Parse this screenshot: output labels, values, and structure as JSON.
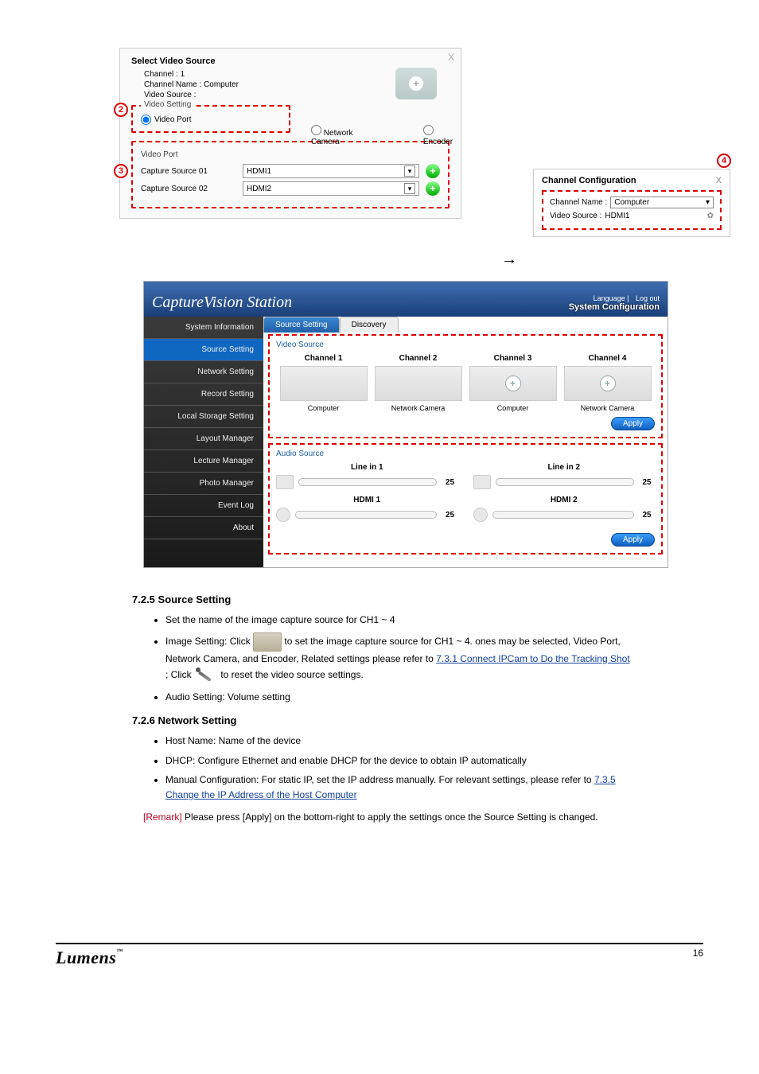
{
  "dialog": {
    "title": "Select Video Source",
    "channel_lbl": "Channel : 1",
    "channel_name_lbl": "Channel Name :  Computer",
    "video_source_lbl": "Video Source :",
    "video_setting_legend": "Video Setting",
    "radios": {
      "port": "Video Port",
      "cam": "Network Camera",
      "enc": "Encoder"
    },
    "video_port_title": "Video Port",
    "cap1_lbl": "Capture Source 01",
    "cap1_val": "HDMI1",
    "cap2_lbl": "Capture Source 02",
    "cap2_val": "HDMI2"
  },
  "cc": {
    "title": "Channel Configuration",
    "name_lbl": "Channel Name  :",
    "name_val": "Computer",
    "src_lbl": "Video Source   :",
    "src_val": "HDMI1"
  },
  "markers": {
    "m2": "2",
    "m3": "3",
    "m4": "4"
  },
  "cvs": {
    "title": "CaptureVision Station",
    "lang": "Language",
    "logout": "Log out",
    "syscfg": "System Configuration",
    "nav": {
      "sysinfo": "System Information",
      "source": "Source Setting",
      "network": "Network Setting",
      "record": "Record Setting",
      "storage": "Local Storage Setting",
      "layout": "Layout Manager",
      "lecture": "Lecture Manager",
      "photo": "Photo Manager",
      "event": "Event Log",
      "about": "About"
    },
    "tabs": {
      "source": "Source Setting",
      "discovery": "Discovery"
    },
    "video_src_title": "Video Source",
    "channels": {
      "c1": {
        "hd": "Channel 1",
        "cap": "Computer"
      },
      "c2": {
        "hd": "Channel 2",
        "cap": "Network Camera"
      },
      "c3": {
        "hd": "Channel 3",
        "cap": "Computer"
      },
      "c4": {
        "hd": "Channel 4",
        "cap": "Network Camera"
      }
    },
    "apply": "Apply",
    "audio_src_title": "Audio Source",
    "audio": {
      "l1": {
        "tt": "Line in 1",
        "val": "25"
      },
      "l2": {
        "tt": "Line in 2",
        "val": "25"
      },
      "h1": {
        "tt": "HDMI 1",
        "val": "25"
      },
      "h2": {
        "tt": "HDMI 2",
        "val": "25"
      }
    }
  },
  "sec": {
    "h725": "7.2.5 Source Setting",
    "b1": "Set the name of the image capture source for CH1 ~ 4",
    "b2a": "Image Setting: Click ",
    "b2b": " to set the image capture source for CH1 ~ 4. ",
    "b2c": "ones may be selected, Video Port, Network Camera, and Encoder, Related settings please refer to ",
    "b2link": "7.3.1 Connect IPCam to Do the Tracking Shot",
    "b2d": "; Click ",
    "b2e": " to reset the video source settings.",
    "b3": "Audio Setting: Volume setting",
    "h726": "7.2.6 Network Setting",
    "c1": "Host Name: Name of the device",
    "c2": "DHCP: Configure Ethernet and enable DHCP for the device to obtain IP automatically",
    "c3a": "Manual Configuration: For static IP, set the IP address manually. For relevant settings, please refer to ",
    "c3link": "7.3.5 Change the IP Address of the Host Computer",
    "rmk_tag": "[Remark]",
    "rmk_txt": " Please press [Apply] on the bottom-right to apply the settings once the Source Setting is changed."
  },
  "footer": {
    "logo": "Lumens",
    "tm": "™",
    "page": "16"
  }
}
